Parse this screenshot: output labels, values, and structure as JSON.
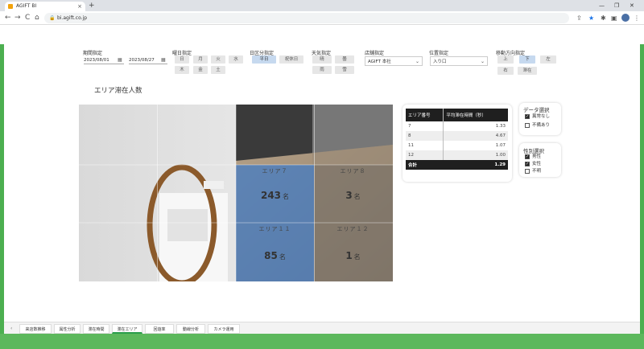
{
  "browser": {
    "tab_title": "AGIFT BI",
    "tab_close": "×",
    "new_tab": "+",
    "url": "bi.agift.co.jp",
    "back": "←",
    "forward": "→",
    "reload": "C",
    "home": "⌂",
    "lock": "🔒",
    "win_minimize": "—",
    "win_restore": "❐",
    "win_close": "✕",
    "share": "⇪",
    "star": "★",
    "extensions": "✱",
    "sidepanel": "▣",
    "menu": "⋮"
  },
  "filters": {
    "period": {
      "label": "期間指定",
      "start": "2023/08/01",
      "end": "2023/08/27",
      "cal_icon": "▦"
    },
    "weekday": {
      "label": "曜日指定",
      "options": [
        "日",
        "月",
        "火",
        "水",
        "木",
        "金",
        "土"
      ]
    },
    "daytype": {
      "label": "日区分指定",
      "options": [
        "平日",
        "祝休日"
      ]
    },
    "weather": {
      "label": "天気指定",
      "options": [
        "晴",
        "曇",
        "雨",
        "雪"
      ]
    },
    "store": {
      "label": "店舗指定",
      "value": "AGIFT 本社",
      "chevron": "⌄"
    },
    "position": {
      "label": "位置指定",
      "value": "入り口",
      "chevron": "⌄"
    },
    "direction": {
      "label": "移動方向指定",
      "options": [
        "上",
        "下",
        "左",
        "右",
        "滞在"
      ]
    }
  },
  "page_title": "エリア滞在人数",
  "zones": [
    {
      "label": "エリア７",
      "count": "243",
      "unit": "名"
    },
    {
      "label": "エリア８",
      "count": "3",
      "unit": "名"
    },
    {
      "label": "エリア１１",
      "count": "85",
      "unit": "名"
    },
    {
      "label": "エリア１２",
      "count": "1",
      "unit": "名"
    }
  ],
  "table": {
    "headers": [
      "エリア番号",
      "平均滞在時間（秒）"
    ],
    "rows": [
      [
        "7",
        "1.33"
      ],
      [
        "8",
        "4.67"
      ],
      [
        "11",
        "1.07"
      ],
      [
        "12",
        "1.00"
      ]
    ],
    "total": [
      "合計",
      "1.29"
    ]
  },
  "data_select": {
    "title": "データ選択",
    "options": [
      {
        "label": "異常なし",
        "checked": true
      },
      {
        "label": "不備あり",
        "checked": false
      }
    ]
  },
  "gender_select": {
    "title": "性別選択",
    "options": [
      {
        "label": "男性",
        "checked": true
      },
      {
        "label": "女性",
        "checked": true
      },
      {
        "label": "不明",
        "checked": false
      }
    ]
  },
  "page_tabs": {
    "nav": "‹",
    "items": [
      "来店数推移",
      "属性分析",
      "滞在時間",
      "滞在エリア",
      "回遊率",
      "動線分析",
      "カメラ運用"
    ],
    "active_index": 3
  },
  "colors": {
    "accent_green": "#4caf50",
    "selected_zone_blue": "#4a7fbf",
    "table_header": "#1f1f1f"
  }
}
